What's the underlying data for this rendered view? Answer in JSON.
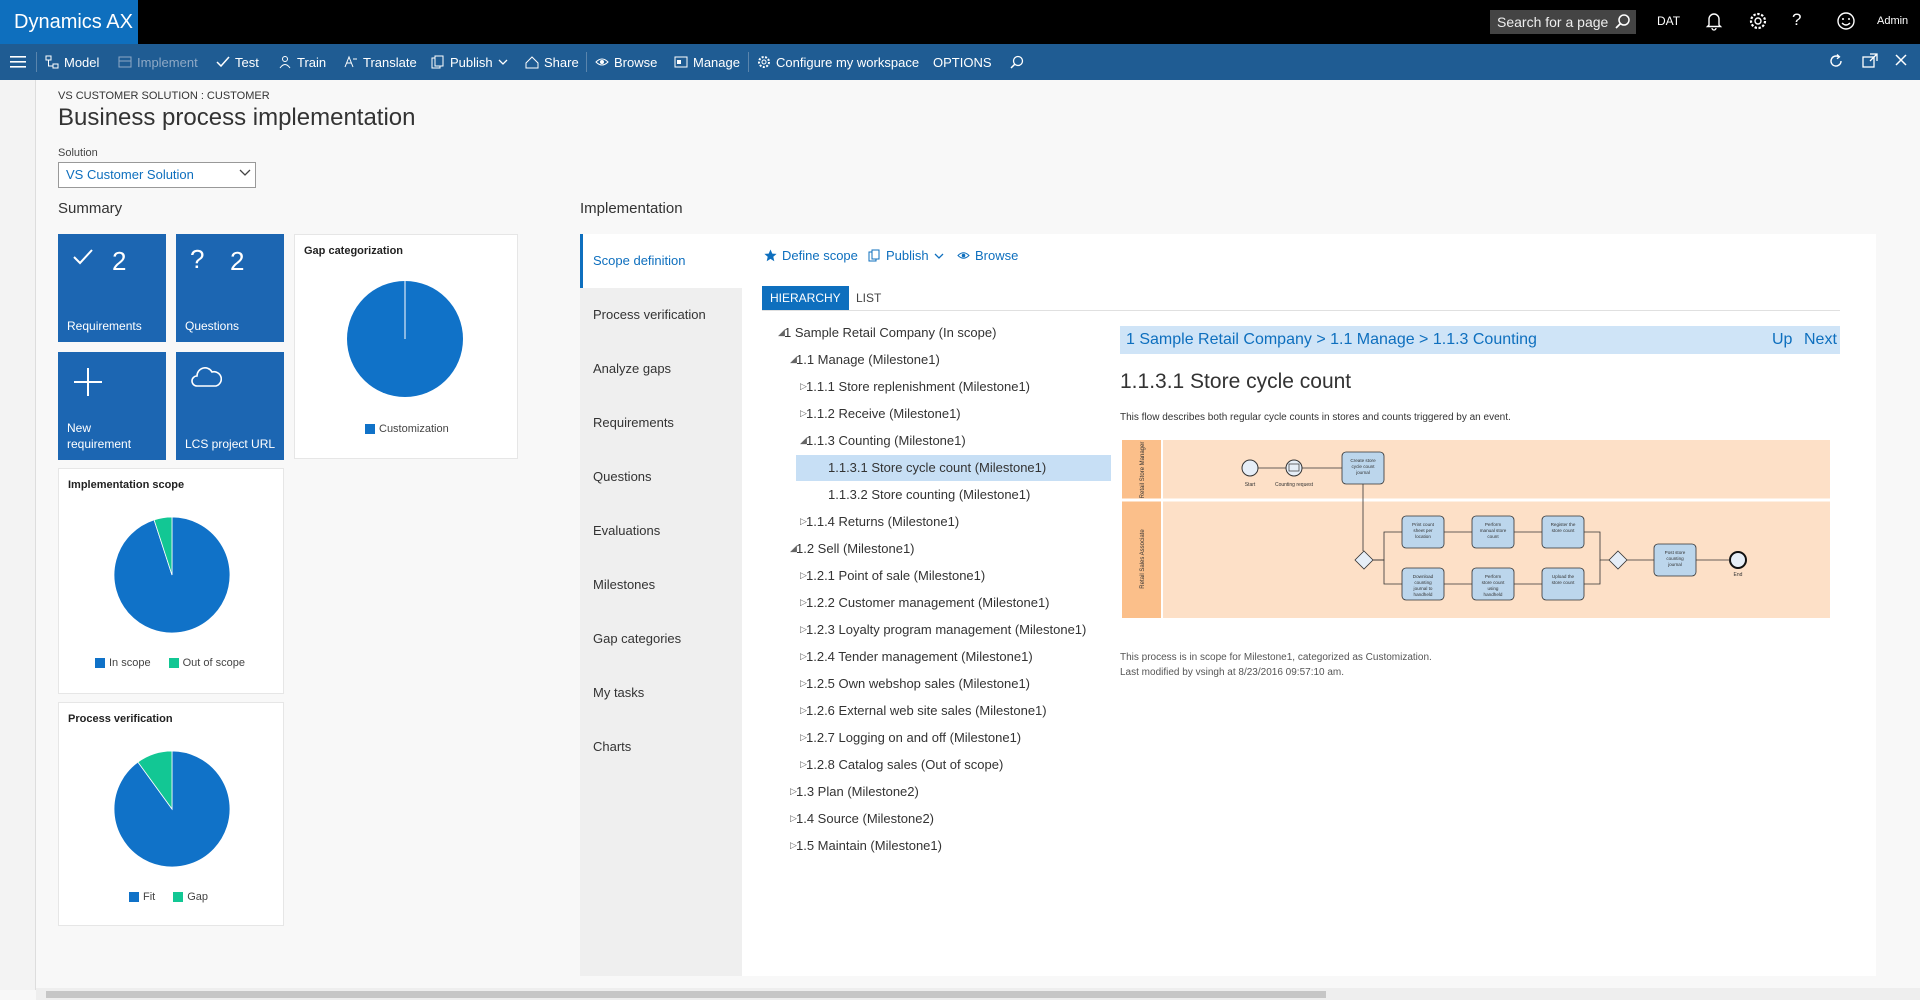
{
  "app": {
    "brand": "Dynamics AX"
  },
  "topbar": {
    "search_placeholder": "Search for a page",
    "company": "DAT",
    "user": "Admin"
  },
  "actions": {
    "model": "Model",
    "implement": "Implement",
    "test": "Test",
    "train": "Train",
    "translate": "Translate",
    "publish": "Publish",
    "share": "Share",
    "browse": "Browse",
    "manage": "Manage",
    "configure": "Configure my workspace",
    "options": "OPTIONS"
  },
  "header": {
    "breadcrumb": "VS CUSTOMER SOLUTION : CUSTOMER",
    "title": "Business process implementation",
    "solution_label": "Solution",
    "solution_value": "VS Customer Solution"
  },
  "summary": {
    "title": "Summary",
    "tiles": [
      {
        "label": "Requirements",
        "count": "2",
        "icon": "check-icon"
      },
      {
        "label": "Questions",
        "count": "2",
        "icon": "question-icon"
      },
      {
        "label": "New requirement",
        "icon": "plus-icon"
      },
      {
        "label": "LCS project URL",
        "icon": "cloud-icon"
      }
    ]
  },
  "charts_meta": {
    "gap": {
      "title": "Gap categorization",
      "legend": [
        "Customization"
      ]
    },
    "scope": {
      "title": "Implementation scope",
      "legend": [
        "In scope",
        "Out of scope"
      ]
    },
    "verification": {
      "title": "Process verification",
      "legend": [
        "Fit",
        "Gap"
      ]
    }
  },
  "chart_data": [
    {
      "type": "pie",
      "title": "Gap categorization",
      "labels": [
        "Customization"
      ],
      "values": [
        100
      ],
      "colors": [
        "#1072c8"
      ]
    },
    {
      "type": "pie",
      "title": "Implementation scope",
      "labels": [
        "In scope",
        "Out of scope"
      ],
      "values": [
        95,
        5
      ],
      "colors": [
        "#1072c8",
        "#12c794"
      ]
    },
    {
      "type": "pie",
      "title": "Process verification",
      "labels": [
        "Fit",
        "Gap"
      ],
      "values": [
        90,
        10
      ],
      "colors": [
        "#1072c8",
        "#12c794"
      ]
    }
  ],
  "implementation": {
    "title": "Implementation",
    "nav": [
      "Scope definition",
      "Process verification",
      "Analyze gaps",
      "Requirements",
      "Questions",
      "Evaluations",
      "Milestones",
      "Gap categories",
      "My tasks",
      "Charts"
    ],
    "sub_actions": {
      "define_scope": "Define scope",
      "publish": "Publish",
      "browse": "Browse"
    },
    "tabs": [
      "HIERARCHY",
      "LIST"
    ],
    "tree": [
      {
        "text": "1 Sample Retail Company (In scope)",
        "level": 0,
        "state": "expanded"
      },
      {
        "text": "1.1 Manage (Milestone1)",
        "level": 1,
        "state": "expanded"
      },
      {
        "text": "1.1.1 Store replenishment (Milestone1)",
        "level": 2,
        "state": "collapsed"
      },
      {
        "text": "1.1.2 Receive (Milestone1)",
        "level": 2,
        "state": "collapsed"
      },
      {
        "text": "1.1.3 Counting (Milestone1)",
        "level": 2,
        "state": "expanded"
      },
      {
        "text": "1.1.3.1 Store cycle count (Milestone1)",
        "level": 3,
        "state": "leaf",
        "selected": true
      },
      {
        "text": "1.1.3.2 Store counting (Milestone1)",
        "level": 3,
        "state": "leaf"
      },
      {
        "text": "1.1.4 Returns (Milestone1)",
        "level": 2,
        "state": "collapsed"
      },
      {
        "text": "1.2 Sell (Milestone1)",
        "level": 1,
        "state": "expanded"
      },
      {
        "text": "1.2.1 Point of sale (Milestone1)",
        "level": 2,
        "state": "collapsed"
      },
      {
        "text": "1.2.2 Customer management (Milestone1)",
        "level": 2,
        "state": "collapsed"
      },
      {
        "text": "1.2.3 Loyalty program management (Milestone1)",
        "level": 2,
        "state": "collapsed"
      },
      {
        "text": "1.2.4 Tender management (Milestone1)",
        "level": 2,
        "state": "collapsed"
      },
      {
        "text": "1.2.5 Own webshop sales (Milestone1)",
        "level": 2,
        "state": "collapsed"
      },
      {
        "text": "1.2.6 External web site sales (Milestone1)",
        "level": 2,
        "state": "collapsed"
      },
      {
        "text": "1.2.7 Logging on and off (Milestone1)",
        "level": 2,
        "state": "collapsed"
      },
      {
        "text": "1.2.8 Catalog sales (Out of scope)",
        "level": 2,
        "state": "collapsed"
      },
      {
        "text": "1.3 Plan (Milestone2)",
        "level": 1,
        "state": "collapsed"
      },
      {
        "text": "1.4 Source (Milestone2)",
        "level": 1,
        "state": "collapsed"
      },
      {
        "text": "1.5 Maintain (Milestone1)",
        "level": 1,
        "state": "collapsed"
      }
    ],
    "detail": {
      "breadcrumb": "1 Sample Retail Company > 1.1 Manage > 1.1.3 Counting",
      "up": "Up",
      "next": "Next",
      "title": "1.1.3.1 Store cycle count",
      "description": "This flow describes both regular cycle counts in stores and counts triggered by an event.",
      "scope_note": "This process is in scope for Milestone1, categorized as Customization.",
      "modified_note": "Last modified by vsingh at 8/23/2016 09:57:10 am."
    },
    "diagram": {
      "lanes": [
        "Retail Store Manager",
        "Retail Sales Associate"
      ],
      "events": [
        "Start",
        "Counting request",
        "End"
      ],
      "tasks": [
        "Create store cycle count journal",
        "Print count sheet per location",
        "Perform manual store count",
        "Register the store count",
        "Post store counting journal",
        "Download counting journal to handheld devices",
        "Perform store count using handheld device",
        "Upload the store count"
      ]
    }
  }
}
